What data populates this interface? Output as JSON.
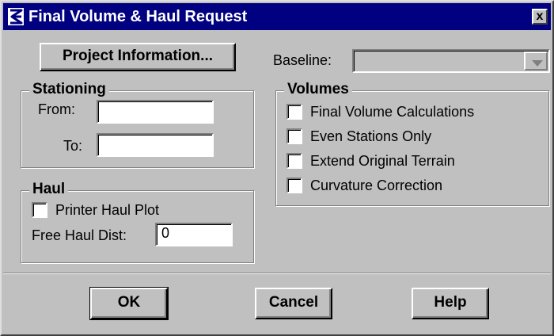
{
  "window": {
    "title": "Final Volume & Haul Request",
    "close_label": "x"
  },
  "project_info_button": "Project Information...",
  "baseline": {
    "label": "Baseline:",
    "value": ""
  },
  "stationing": {
    "title": "Stationing",
    "from_label": "From:",
    "from_value": "",
    "to_label": "To:",
    "to_value": ""
  },
  "haul": {
    "title": "Haul",
    "printer_haul_plot_label": "Printer Haul Plot",
    "printer_haul_plot_checked": false,
    "free_haul_label": "Free Haul Dist:",
    "free_haul_value": "0"
  },
  "volumes": {
    "title": "Volumes",
    "options": [
      {
        "label": "Final Volume Calculations",
        "checked": false
      },
      {
        "label": "Even Stations Only",
        "checked": false
      },
      {
        "label": "Extend Original Terrain",
        "checked": false
      },
      {
        "label": "Curvature Correction",
        "checked": false
      }
    ]
  },
  "buttons": {
    "ok": "OK",
    "cancel": "Cancel",
    "help": "Help"
  },
  "icons": {
    "app": "app-icon",
    "close": "close-icon",
    "dropdown": "chevron-down-icon"
  },
  "colors": {
    "titlebar": "#000080",
    "dialog_bg": "#c0c0c0"
  }
}
